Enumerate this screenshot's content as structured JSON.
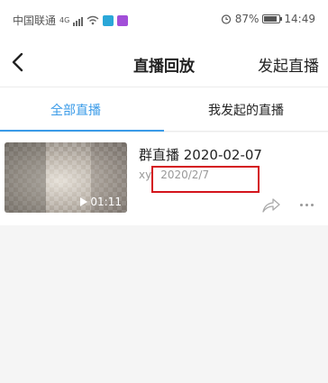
{
  "status_bar": {
    "carrier": "中国联通",
    "network": "4G",
    "battery_percent": "87%",
    "time": "14:49"
  },
  "nav": {
    "title": "直播回放",
    "action": "发起直播",
    "back_icon": "chevron-left-icon"
  },
  "tabs": [
    {
      "label": "全部直播",
      "active": true
    },
    {
      "label": "我发起的直播",
      "active": false
    }
  ],
  "recordings": [
    {
      "title": "群直播 2020-02-07",
      "host": "xy",
      "date": "2020/2/7",
      "duration": "01:11"
    }
  ],
  "colors": {
    "accent": "#3a9be8",
    "highlight": "#d4141c"
  }
}
